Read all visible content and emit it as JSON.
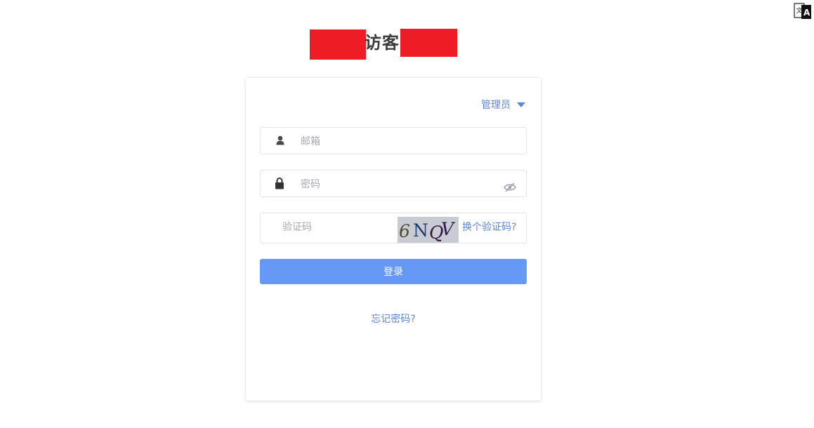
{
  "header": {
    "title": "访客"
  },
  "login_form": {
    "role_selector": "管理员",
    "email_placeholder": "邮箱",
    "password_placeholder": "密码",
    "captcha_placeholder": "验证码",
    "captcha_text": "6NQV",
    "refresh_captcha": "换个验证码?",
    "login_button": "登录",
    "forgot_password": "忘记密码?"
  },
  "colors": {
    "accent": "#5b86d6",
    "button": "#6699f5",
    "redaction": "#ee1c25",
    "title": "#3c3c3c"
  },
  "icons": [
    "translate-icon",
    "user-icon",
    "lock-icon",
    "eye-off-icon",
    "caret-down-icon"
  ]
}
